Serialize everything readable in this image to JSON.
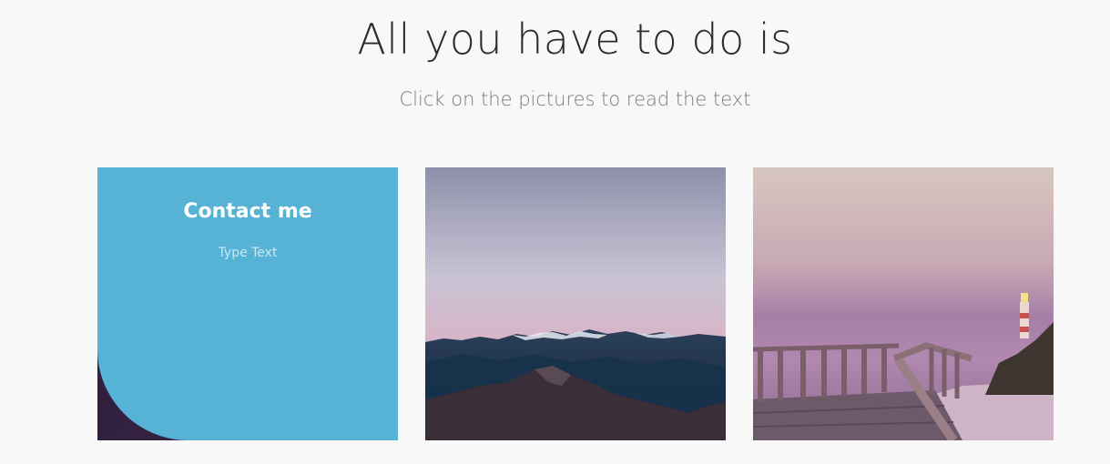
{
  "header": {
    "title": "All you have to do is",
    "subtitle": "Click on the pictures to read the text"
  },
  "cards": [
    {
      "overlay_title": "Contact me",
      "overlay_text": "Type Text",
      "image": "night-sky-photo",
      "overlay_color": "#57b3d6"
    },
    {
      "image": "mountain-range-photo"
    },
    {
      "image": "boardwalk-lighthouse-photo"
    }
  ],
  "colors": {
    "background": "#f8f8f8",
    "accent": "#57b3d6"
  }
}
